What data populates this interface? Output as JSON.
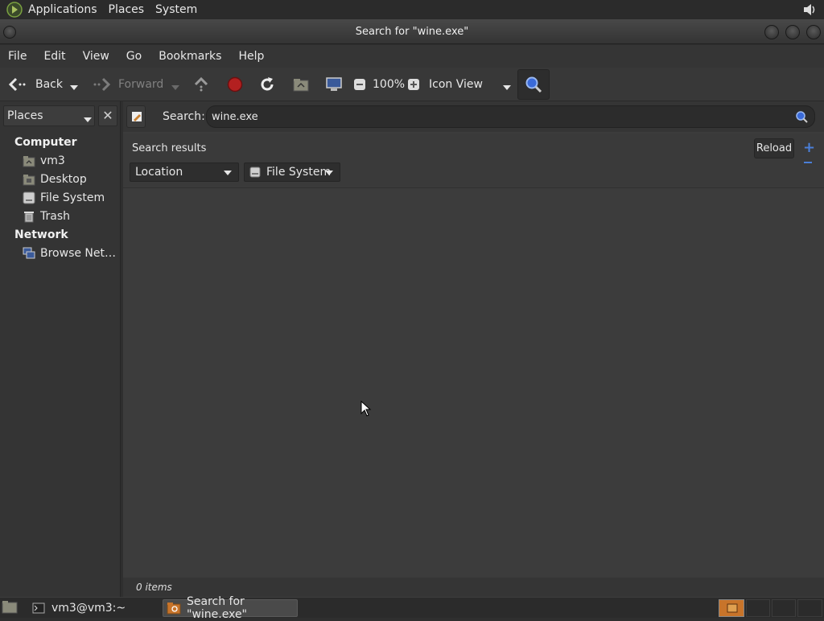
{
  "top_panel": {
    "menus": [
      "Applications",
      "Places",
      "System"
    ]
  },
  "window": {
    "title": "Search for \"wine.exe\""
  },
  "menubar": {
    "items": [
      "File",
      "Edit",
      "View",
      "Go",
      "Bookmarks",
      "Help"
    ]
  },
  "toolbar": {
    "back_label": "Back",
    "forward_label": "Forward",
    "zoom_level": "100%",
    "view_mode": "Icon View"
  },
  "sidebar": {
    "selector_label": "Places",
    "sections": [
      {
        "heading": "Computer",
        "items": [
          "vm3",
          "Desktop",
          "File System",
          "Trash"
        ]
      },
      {
        "heading": "Network",
        "items": [
          "Browse Net…"
        ]
      }
    ]
  },
  "search": {
    "label": "Search:",
    "query": "wine.exe",
    "results_label": "Search results",
    "reload_label": "Reload",
    "filter_type": "Location",
    "filter_value": "File System"
  },
  "status": {
    "items_count": "0 items"
  },
  "taskbar": {
    "tasks": [
      "vm3@vm3:~",
      "Search for \"wine.exe\""
    ]
  },
  "colors": {
    "accent_blue": "#4a7fd8",
    "stop_red": "#b32020"
  }
}
